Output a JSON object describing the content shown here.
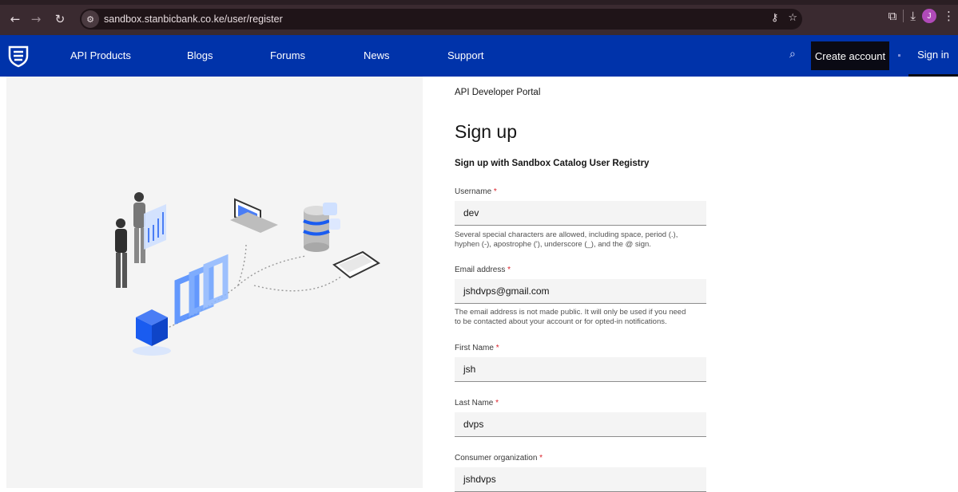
{
  "browser": {
    "url": "sandbox.stanbicbank.co.ke/user/register",
    "avatar_initial": "J"
  },
  "nav": {
    "items": [
      "API Products",
      "Blogs",
      "Forums",
      "News",
      "Support"
    ],
    "create_account": "Create account",
    "sign_in": "Sign in"
  },
  "page": {
    "portal_name": "API Developer Portal",
    "title": "Sign up",
    "subtitle": "Sign up with Sandbox Catalog User Registry"
  },
  "form": {
    "required_mark": "*",
    "username": {
      "label": "Username",
      "value": "dev",
      "help_line1": "Several special characters are allowed, including space, period (.),",
      "help_line2": "hyphen (-), apostrophe ('), underscore (_), and the @ sign."
    },
    "email": {
      "label": "Email address",
      "value": "jshdvps@gmail.com",
      "help_line1": "The email address is not made public. It will only be used if you need",
      "help_line2": "to be contacted about your account or for opted-in notifications."
    },
    "first_name": {
      "label": "First Name",
      "value": "jsh"
    },
    "last_name": {
      "label": "Last Name",
      "value": "dvps"
    },
    "consumer_org": {
      "label": "Consumer organization",
      "value": "jshdvps"
    }
  },
  "colors": {
    "nav_bg": "#0033aa",
    "create_bg": "#0a0a14",
    "required": "#da1e28",
    "illustration_blue": "#1a5cf0"
  }
}
